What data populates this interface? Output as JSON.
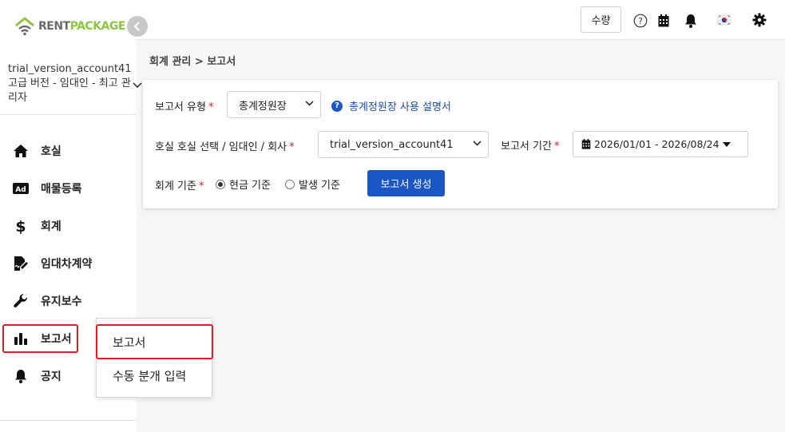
{
  "brand": {
    "rent": "RENT",
    "package": "PACKAGE"
  },
  "account": {
    "name": "trial_version_account41",
    "role": "고급 버전 - 임대인 - 최고 관리자"
  },
  "sidebar": {
    "items": [
      {
        "label": "호실",
        "icon": "home-icon"
      },
      {
        "label": "매물등록",
        "icon": "ad-icon"
      },
      {
        "label": "회계",
        "icon": "dollar-icon"
      },
      {
        "label": "임대차계약",
        "icon": "contract-sign-icon"
      },
      {
        "label": "유지보수",
        "icon": "wrench-icon"
      },
      {
        "label": "보고서",
        "icon": "bar-chart-icon"
      },
      {
        "label": "공지",
        "icon": "bell-icon"
      }
    ]
  },
  "popover": {
    "items": [
      "보고서",
      "수동 분개 입력"
    ]
  },
  "header": {
    "qty_label": "수량"
  },
  "breadcrumb": "회계 관리 > 보고서",
  "form": {
    "report_type_label": "보고서 유형",
    "report_type_value": "총계정원장",
    "help_link": "총계정원장 사용 설명서",
    "unit_label": "호실 호실 선택 / 임대인 / 회사",
    "unit_value": "trial_version_account41",
    "period_label": "보고서 기간",
    "period_value": "2026/01/01 - 2026/08/24",
    "basis_label": "회계 기준",
    "basis_cash": "현금 기준",
    "basis_accrual": "발생 기준",
    "generate_label": "보고서 생성",
    "required_mark": "*"
  }
}
